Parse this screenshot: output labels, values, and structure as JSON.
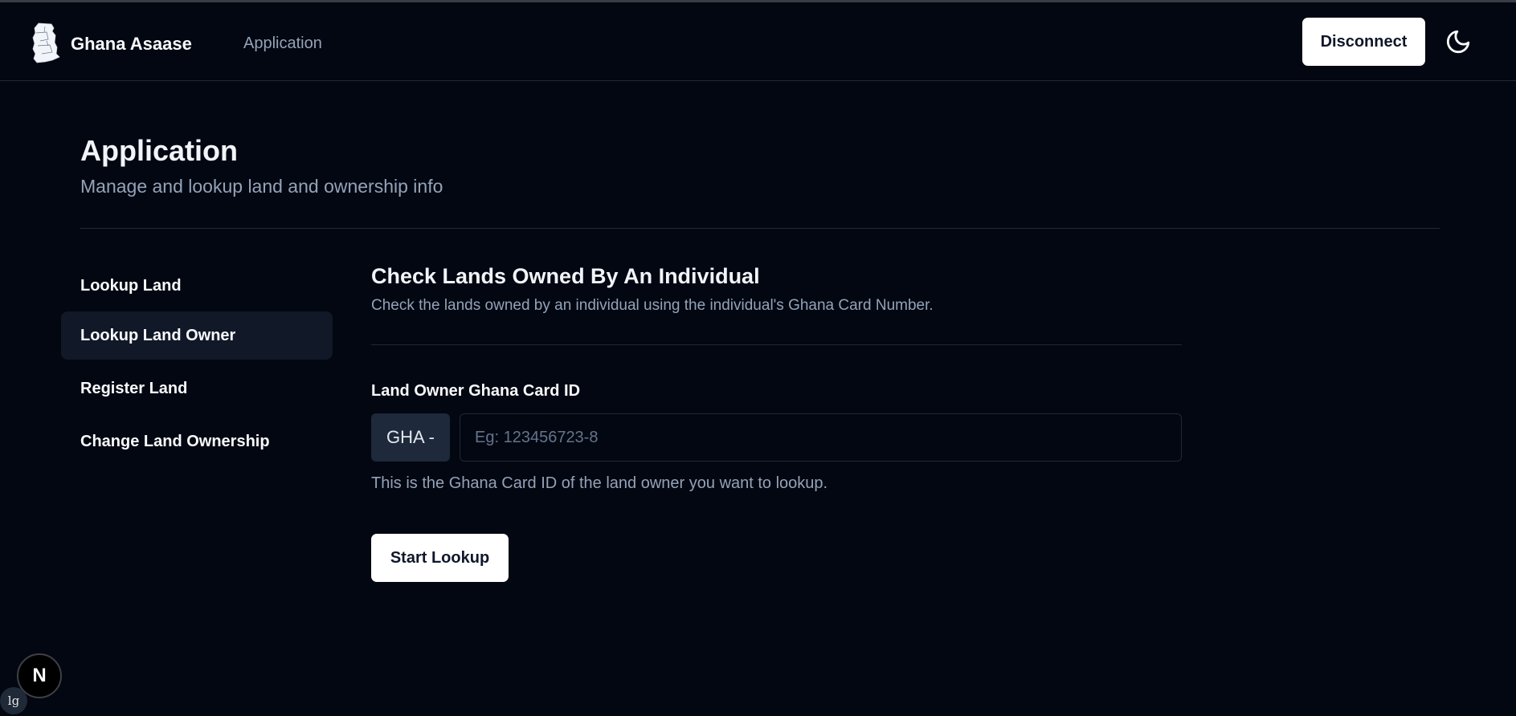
{
  "header": {
    "logo_icon": "ghana-map-icon",
    "brand": "Ghana Asaase",
    "nav_link": "Application",
    "disconnect_label": "Disconnect",
    "theme_icon": "moon-icon"
  },
  "page": {
    "title": "Application",
    "subtitle": "Manage and lookup land and ownership info"
  },
  "sidebar": {
    "items": [
      {
        "label": "Lookup Land",
        "active": false
      },
      {
        "label": "Lookup Land Owner",
        "active": true
      },
      {
        "label": "Register Land",
        "active": false
      },
      {
        "label": "Change Land Ownership",
        "active": false
      }
    ]
  },
  "form": {
    "title": "Check Lands Owned By An Individual",
    "description": "Check the lands owned by an individual using the individual's Ghana Card Number.",
    "field_label": "Land Owner Ghana Card ID",
    "prefix": "GHA -",
    "input_value": "",
    "input_placeholder": "Eg: 123456723-8",
    "helper_text": "This is the Ghana Card ID of the land owner you want to lookup.",
    "submit_label": "Start Lookup"
  },
  "overlay": {
    "dev_badge": "N",
    "breakpoint": "lg"
  },
  "colors": {
    "background": "#030712",
    "muted_text": "#94a3b8",
    "active_item": "#111827",
    "button_bg": "#ffffff"
  }
}
